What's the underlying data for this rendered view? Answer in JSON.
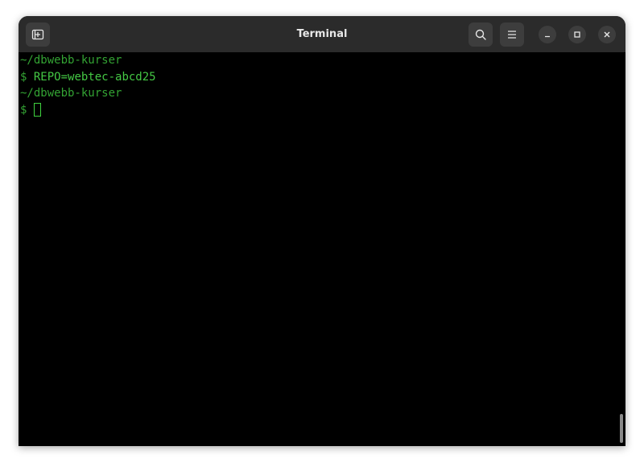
{
  "window": {
    "title": "Terminal"
  },
  "header": {
    "new_tab_icon": "new-tab-icon",
    "search_icon": "search-icon",
    "menu_icon": "hamburger-menu-icon",
    "minimize_icon": "minimize-icon",
    "maximize_icon": "maximize-icon",
    "close_icon": "close-icon"
  },
  "terminal": {
    "lines": [
      {
        "text": "~/dbwebb-kurser"
      },
      {
        "prompt": "$",
        "command": "REPO=webtec-abcd25"
      },
      {
        "text": "~/dbwebb-kurser"
      },
      {
        "prompt": "$",
        "command": ""
      }
    ]
  },
  "colors": {
    "titlebar_bg": "#2b2b2b",
    "terminal_bg": "#000000",
    "terminal_fg": "#3fb43f"
  }
}
